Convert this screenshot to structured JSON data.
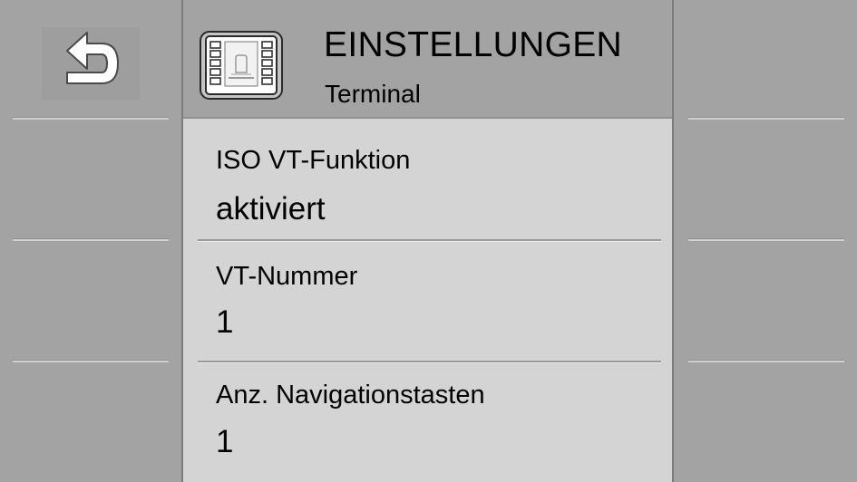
{
  "header": {
    "title": "EINSTELLUNGEN",
    "subtitle": "Terminal",
    "app_icon": "terminal-settings-icon"
  },
  "left_softkeys": {
    "back": {
      "icon": "back-arrow-icon"
    }
  },
  "settings": [
    {
      "label": "ISO VT-Funktion",
      "value": "aktiviert"
    },
    {
      "label": "VT-Nummer",
      "value": "1"
    },
    {
      "label": "Anz. Navigationstasten",
      "value": "1"
    }
  ],
  "colors": {
    "background": "#a3a3a3",
    "content": "#d4d4d4",
    "text": "#000000",
    "icon": "#ffffff"
  }
}
